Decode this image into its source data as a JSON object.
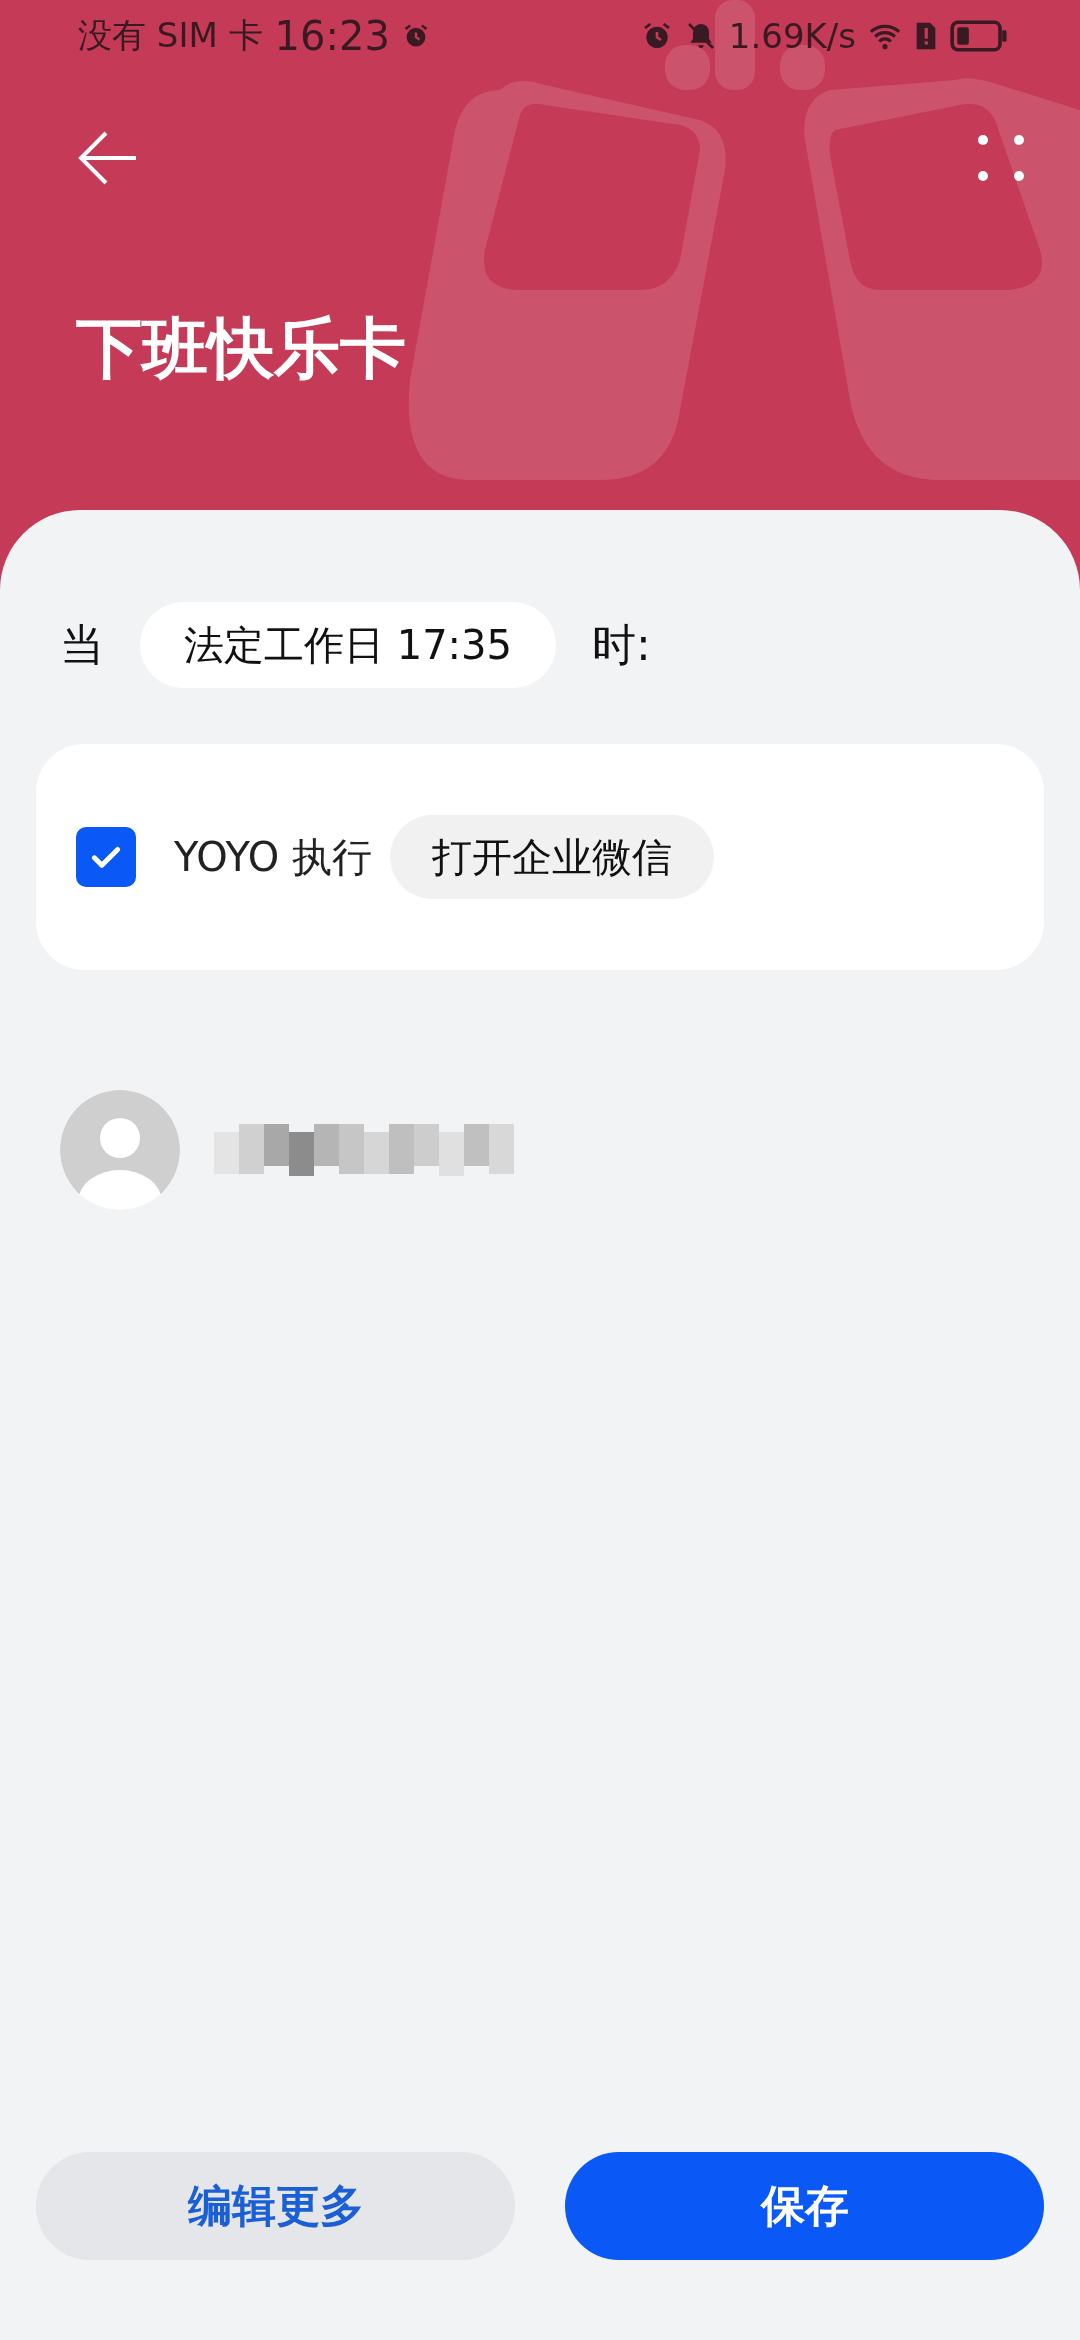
{
  "status_bar": {
    "carrier": "没有 SIM 卡",
    "time": "16:23",
    "net_speed": "1.69K/s"
  },
  "header": {
    "title": "下班快乐卡"
  },
  "condition": {
    "prefix": "当",
    "trigger": "法定工作日 17:35",
    "suffix": "时:"
  },
  "actions": [
    {
      "checked": true,
      "label": "YOYO 执行",
      "action": "打开企业微信"
    }
  ],
  "contact": {
    "kind": "redacted"
  },
  "buttons": [
    {
      "label": "编辑更多",
      "kind": "secondary"
    },
    {
      "label": "保存",
      "kind": "primary"
    }
  ]
}
